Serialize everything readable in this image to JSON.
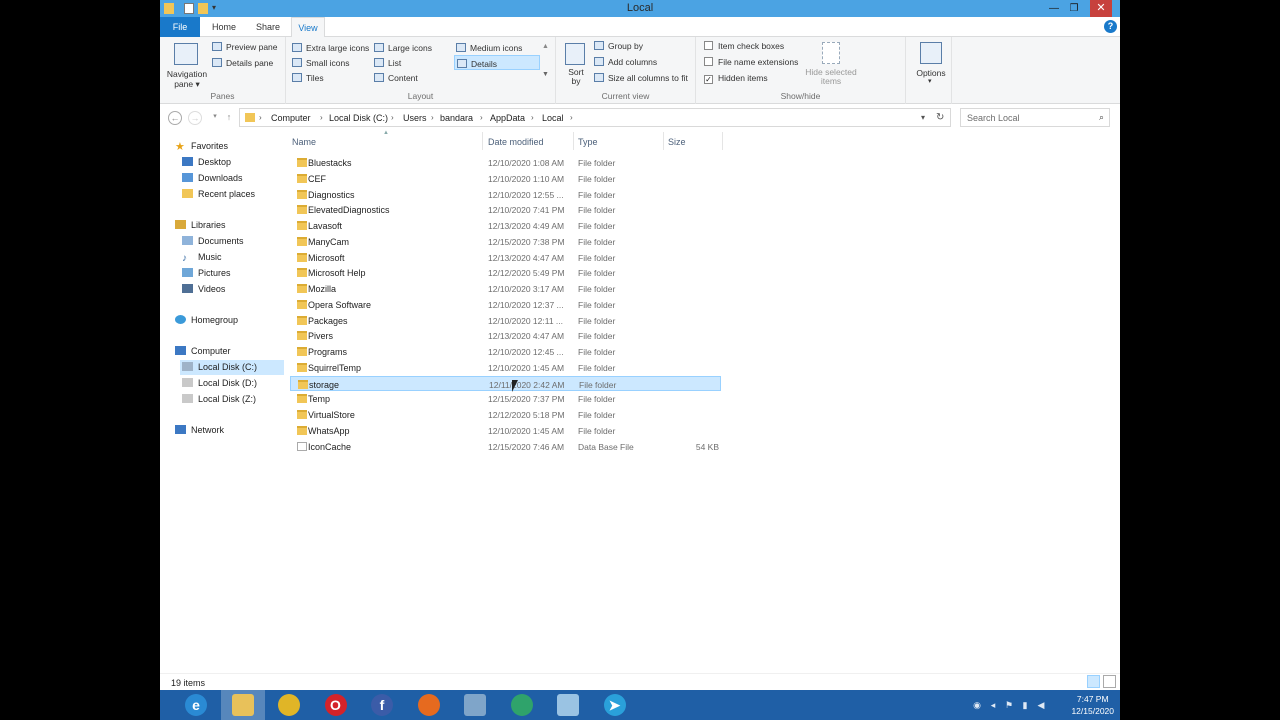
{
  "window": {
    "title": "Local",
    "help": "?"
  },
  "tabs": [
    {
      "label": "File"
    },
    {
      "label": "Home"
    },
    {
      "label": "Share"
    },
    {
      "label": "View"
    }
  ],
  "ribbon": {
    "panes": {
      "group": "Panes",
      "navigation_pane": "Navigation pane",
      "nav_arrow": "▾",
      "preview_pane": "Preview pane",
      "details_pane": "Details pane"
    },
    "layout": {
      "group": "Layout",
      "items": [
        "Extra large icons",
        "Large icons",
        "Medium icons",
        "Small icons",
        "List",
        "Details",
        "Tiles",
        "Content"
      ],
      "selected": "Details"
    },
    "current_view": {
      "group": "Current view",
      "sort_by": "Sort by",
      "group_by": "Group by",
      "add_columns": "Add columns",
      "size_all_columns": "Size all columns to fit"
    },
    "show_hide": {
      "group": "Show/hide",
      "item_check_boxes": "Item check boxes",
      "item_check_boxes_checked": false,
      "file_name_extensions": "File name extensions",
      "file_name_extensions_checked": false,
      "hidden_items": "Hidden items",
      "hidden_items_checked": true,
      "hide_selected_items": "Hide selected items"
    },
    "options": "Options"
  },
  "address": {
    "breadcrumbs": [
      "Computer",
      "Local Disk (C:)",
      "Users",
      "bandara",
      "AppData",
      "Local"
    ],
    "search_placeholder": "Search Local"
  },
  "nav_pane": {
    "favorites": {
      "label": "Favorites",
      "items": [
        "Desktop",
        "Downloads",
        "Recent places"
      ]
    },
    "libraries": {
      "label": "Libraries",
      "items": [
        "Documents",
        "Music",
        "Pictures",
        "Videos"
      ]
    },
    "homegroup": "Homegroup",
    "computer": {
      "label": "Computer",
      "items": [
        "Local Disk (C:)",
        "Local Disk (D:)",
        "Local Disk (Z:)"
      ],
      "selected": "Local Disk (C:)"
    },
    "network": "Network"
  },
  "columns": {
    "name": "Name",
    "date_modified": "Date modified",
    "type": "Type",
    "size": "Size"
  },
  "files": [
    {
      "name": "Bluestacks",
      "date": "12/10/2020 1:08 AM",
      "type": "File folder",
      "size": ""
    },
    {
      "name": "CEF",
      "date": "12/10/2020 1:10 AM",
      "type": "File folder",
      "size": ""
    },
    {
      "name": "Diagnostics",
      "date": "12/10/2020 12:55 ...",
      "type": "File folder",
      "size": ""
    },
    {
      "name": "ElevatedDiagnostics",
      "date": "12/10/2020 7:41 PM",
      "type": "File folder",
      "size": ""
    },
    {
      "name": "Lavasoft",
      "date": "12/13/2020 4:49 AM",
      "type": "File folder",
      "size": ""
    },
    {
      "name": "ManyCam",
      "date": "12/15/2020 7:38 PM",
      "type": "File folder",
      "size": ""
    },
    {
      "name": "Microsoft",
      "date": "12/13/2020 4:47 AM",
      "type": "File folder",
      "size": ""
    },
    {
      "name": "Microsoft Help",
      "date": "12/12/2020 5:49 PM",
      "type": "File folder",
      "size": ""
    },
    {
      "name": "Mozilla",
      "date": "12/10/2020 3:17 AM",
      "type": "File folder",
      "size": ""
    },
    {
      "name": "Opera Software",
      "date": "12/10/2020 12:37 ...",
      "type": "File folder",
      "size": ""
    },
    {
      "name": "Packages",
      "date": "12/10/2020 12:11 ...",
      "type": "File folder",
      "size": ""
    },
    {
      "name": "Pivers",
      "date": "12/13/2020 4:47 AM",
      "type": "File folder",
      "size": ""
    },
    {
      "name": "Programs",
      "date": "12/10/2020 12:45 ...",
      "type": "File folder",
      "size": ""
    },
    {
      "name": "SquirrelTemp",
      "date": "12/10/2020 1:45 AM",
      "type": "File folder",
      "size": ""
    },
    {
      "name": "storage",
      "date": "12/11/2020 2:42 AM",
      "type": "File folder",
      "size": ""
    },
    {
      "name": "Temp",
      "date": "12/15/2020 7:37 PM",
      "type": "File folder",
      "size": ""
    },
    {
      "name": "VirtualStore",
      "date": "12/12/2020 5:18 PM",
      "type": "File folder",
      "size": ""
    },
    {
      "name": "WhatsApp",
      "date": "12/10/2020 1:45 AM",
      "type": "File folder",
      "size": ""
    },
    {
      "name": "IconCache",
      "date": "12/15/2020 7:46 AM",
      "type": "Data Base File",
      "size": "54 KB"
    }
  ],
  "selected_file": "storage",
  "status": {
    "item_count": "19 items"
  },
  "taskbar": {
    "apps": [
      {
        "name": "internet-explorer",
        "glyph": "e",
        "color": "#2a8ad4"
      },
      {
        "name": "file-explorer",
        "glyph": "",
        "color": "#e8c15a"
      },
      {
        "name": "chrome",
        "glyph": "",
        "color": "#e0b527"
      },
      {
        "name": "opera",
        "glyph": "O",
        "color": "#d4232a"
      },
      {
        "name": "facebook",
        "glyph": "f",
        "color": "#3b5ca8"
      },
      {
        "name": "firefox",
        "glyph": "",
        "color": "#e66a1f"
      },
      {
        "name": "control-panel",
        "glyph": "",
        "color": "#7fa5c9"
      },
      {
        "name": "browser",
        "glyph": "",
        "color": "#2fa36b"
      },
      {
        "name": "notepad",
        "glyph": "",
        "color": "#9ac3e3"
      },
      {
        "name": "telegram",
        "glyph": "➤",
        "color": "#2aa0da"
      }
    ],
    "time": "7:47 PM",
    "date": "12/15/2020"
  }
}
